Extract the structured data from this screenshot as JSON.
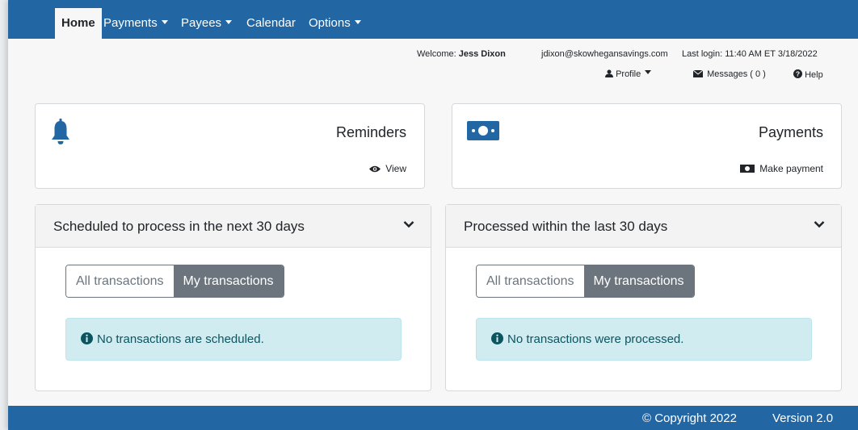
{
  "nav": {
    "items": [
      {
        "label": "Home"
      },
      {
        "label": "Payments"
      },
      {
        "label": "Payees"
      },
      {
        "label": "Calendar"
      },
      {
        "label": "Options"
      }
    ]
  },
  "user": {
    "welcome_prefix": "Welcome:",
    "name": "Jess Dixon",
    "email": "jdixon@skowhegansavings.com",
    "last_login": "Last login: 11:40 AM ET 3/18/2022",
    "profile_label": "Profile",
    "messages_label": "Messages ( 0 )",
    "help_label": "Help"
  },
  "reminders_card": {
    "title": "Reminders",
    "link": "View",
    "icon": "bell-icon"
  },
  "payments_card": {
    "title": "Payments",
    "link": "Make payment",
    "icon": "money-bill-icon"
  },
  "scheduled_panel": {
    "title": "Scheduled to process in the next 30 days",
    "toggle_all": "All transactions",
    "toggle_mine": "My transactions",
    "message": "No transactions are scheduled."
  },
  "processed_panel": {
    "title": "Processed within the last 30 days",
    "toggle_all": "All transactions",
    "toggle_mine": "My transactions",
    "message": "No transactions were processed."
  },
  "footer": {
    "copyright": "© Copyright  2022",
    "version": "Version 2.0"
  },
  "colors": {
    "brand": "#2266a4",
    "alert_bg": "#d1ecf1",
    "toggle_active": "#6c757d"
  }
}
